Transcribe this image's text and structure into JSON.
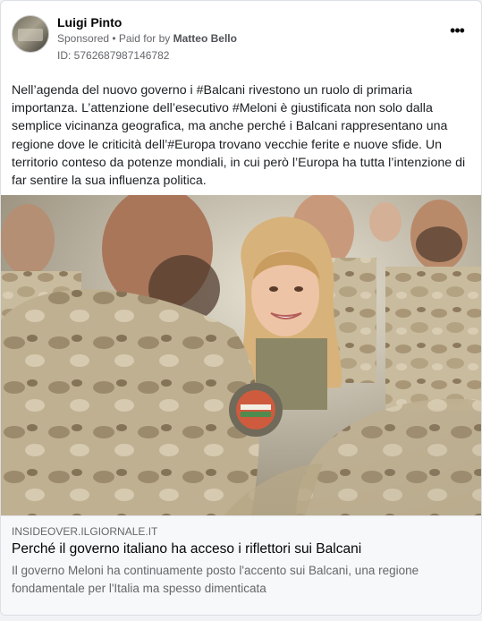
{
  "post": {
    "author": "Luigi Pinto",
    "sponsored": "Sponsored",
    "separator": " • ",
    "paid_for_by_prefix": "Paid for by ",
    "paid_for_by": "Matteo Bello",
    "library_id": "ID: 5762687987146782",
    "more_icon": "more-horizontal-icon",
    "more_label": "•••",
    "text": "Nell’agenda del nuovo governo i #Balcani rivestono un ruolo di primaria importanza. L’attenzione dell’esecutivo #Meloni è giustificata non solo dalla semplice vicinanza geografica, ma anche perché i Balcani rappresentano una regione dove le criticità dell’#Europa trovano vecchie ferite e nuove sfide. Un territorio conteso da potenze mondiali, in cui però l’Europa ha tutta l’intenzione di far sentire la sua influenza politica."
  },
  "link": {
    "domain": "INSIDEOVER.ILGIORNALE.IT",
    "headline": "Perché il governo italiano ha acceso i riflettori sui Balcani",
    "description": "Il governo Meloni ha continuamente posto l'accento sui Balcani, una regione fondamentale per l'Italia ma spesso dimenticata"
  },
  "colors": {
    "card_bg": "#ffffff",
    "link_bg": "#f7f8fa",
    "secondary_text": "#65676b",
    "camouflage": "#c2b59a"
  }
}
